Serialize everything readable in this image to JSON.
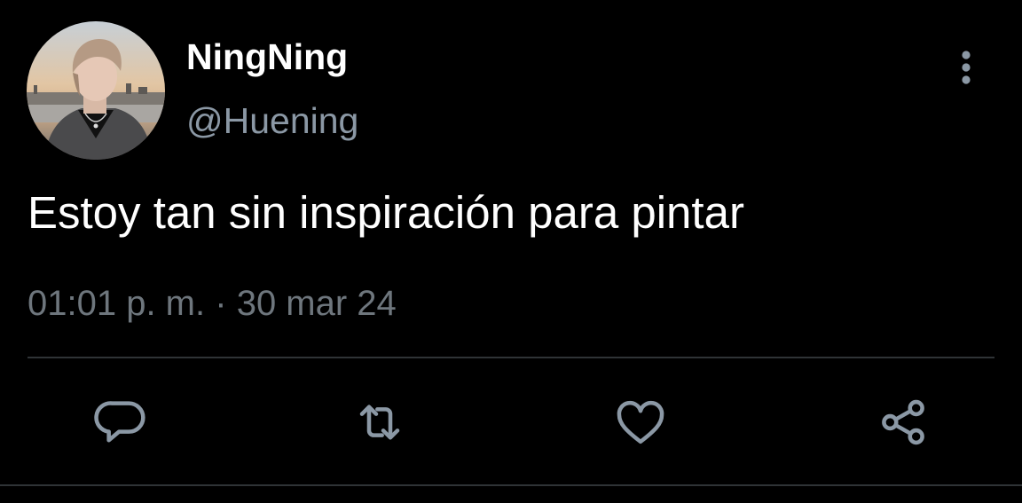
{
  "author": {
    "display_name": "NingNing",
    "handle": "@Huening"
  },
  "tweet": {
    "text": "Estoy tan sin inspiración para pintar",
    "time": "01:01 p. m.",
    "separator": "·",
    "date": "30 mar 24"
  },
  "icons": {
    "more": "more-vertical-icon",
    "reply": "reply-icon",
    "retweet": "retweet-icon",
    "like": "heart-icon",
    "share": "share-icon"
  },
  "colors": {
    "background": "#000000",
    "primary_text": "#ffffff",
    "secondary_text": "#8b98a5",
    "icon": "#8b98a5",
    "divider": "#2f3336"
  }
}
